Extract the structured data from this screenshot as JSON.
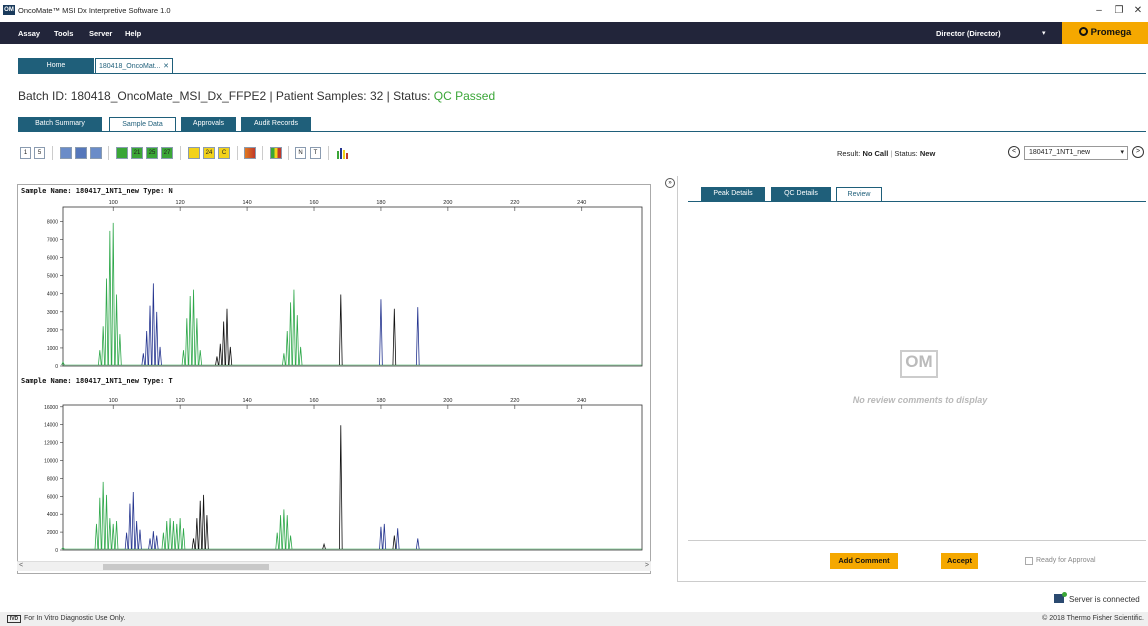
{
  "window": {
    "app_icon": "OM",
    "title": "OncoMate™ MSI Dx Interpretive Software 1.0",
    "minimize": "–",
    "maximize": "❐",
    "close": "✕"
  },
  "menu": {
    "items": [
      "Assay",
      "Tools",
      "Server",
      "Help"
    ],
    "user": "Director (Director)",
    "user_caret": "▾",
    "brand": "Promega"
  },
  "doc_tabs": [
    {
      "label": "Home"
    },
    {
      "label": "180418_OncoMat...",
      "close": "✕"
    }
  ],
  "batch": {
    "prefix": "Batch ID: 180418_OncoMate_MSI_Dx_FFPE2 | Patient Samples: 32 | Status: ",
    "status": "QC Passed",
    "status_color": "#3aa637"
  },
  "section_tabs": [
    {
      "label": "Batch Summary"
    },
    {
      "label": "Sample Data",
      "active": true
    },
    {
      "label": "Approvals"
    },
    {
      "label": "Audit Records"
    }
  ],
  "toolbar": {
    "b1": "1",
    "b5": "5",
    "g21": "21",
    "g25": "25",
    "g27": "27",
    "y24": "24",
    "yC": "C",
    "n": "N",
    "t": "T"
  },
  "result": {
    "result_label": "Result:",
    "result_value": "No Call",
    "status_label": "Status:",
    "status_value": "New"
  },
  "nav": {
    "prev": "<",
    "next": ">",
    "selected_sample": "180417_1NT1_new",
    "dropdown": "▾"
  },
  "plots": [
    {
      "sample_label": "Sample Name: 180417_1NT1_new  Type: N",
      "x_ticks": [
        "100",
        "120",
        "140",
        "160",
        "180",
        "200",
        "220",
        "240"
      ],
      "y_ticks": [
        "0",
        "1000",
        "2000",
        "3000",
        "4000",
        "5000",
        "6000",
        "7000",
        "8000"
      ],
      "ymax": 8800
    },
    {
      "sample_label": "Sample Name: 180417_1NT1_new  Type: T",
      "x_ticks": [
        "100",
        "120",
        "140",
        "160",
        "180",
        "200",
        "220",
        "240"
      ],
      "y_ticks": [
        "0",
        "2000",
        "4000",
        "6000",
        "8000",
        "10000",
        "12000",
        "14000",
        "16000"
      ],
      "ymax": 16200
    }
  ],
  "colors": {
    "green": "#2ea84a",
    "blue": "#24348f",
    "black": "#111111",
    "accent": "#1f5f7a",
    "yellow": "#f5a800"
  },
  "collapse_btn": "»",
  "scroll": {
    "left": "<",
    "right": ">"
  },
  "right_tabs": [
    {
      "label": "Peak Details"
    },
    {
      "label": "QC Details"
    },
    {
      "label": "Review",
      "active": true
    }
  ],
  "review": {
    "logo": "OM",
    "empty_text": "No review comments to display",
    "add_comment": "Add Comment",
    "accept": "Accept",
    "ready_label": "Ready for Approval"
  },
  "status_bar": {
    "server": "Server is connected",
    "ivd": "IVD",
    "footer_left": "For In Vitro Diagnostic Use Only.",
    "footer_right": "© 2018 Thermo Fisher Scientific."
  }
}
